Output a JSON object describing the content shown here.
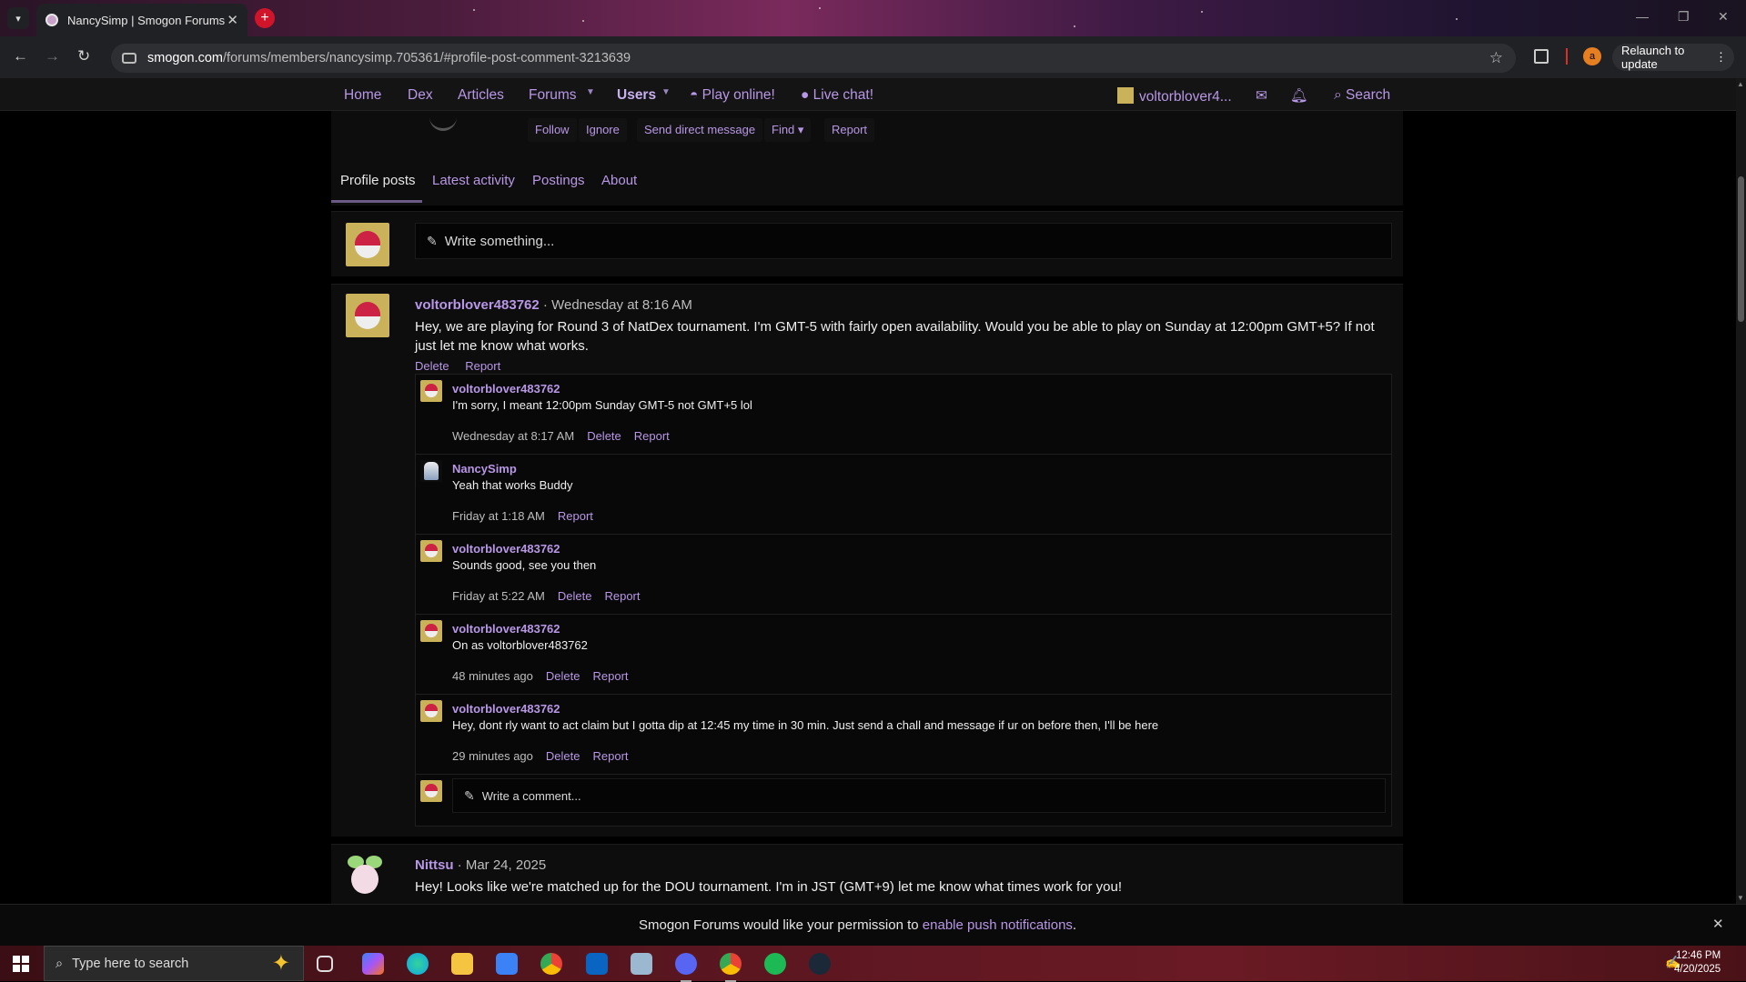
{
  "browser": {
    "tab_title": "NancySimp | Smogon Forums",
    "url_host": "smogon.com",
    "url_path": "/forums/members/nancysimp.705361/#profile-post-comment-3213639",
    "relaunch_label": "Relaunch to update",
    "profile_initial": "a"
  },
  "sitenav": {
    "home": "Home",
    "dex": "Dex",
    "articles": "Articles",
    "forums": "Forums",
    "users": "Users",
    "play_online": "Play online!",
    "live_chat": "Live chat!",
    "account": "voltorblover4...",
    "search": "Search"
  },
  "profile_actions": {
    "follow": "Follow",
    "ignore": "Ignore",
    "send_dm": "Send direct message",
    "find": "Find",
    "report": "Report"
  },
  "profile_tabs": {
    "profile_posts": "Profile posts",
    "latest_activity": "Latest activity",
    "postings": "Postings",
    "about": "About"
  },
  "write_placeholder": "Write something...",
  "post1": {
    "author": "voltorblover483762",
    "time": "· Wednesday at 8:16 AM",
    "body": "Hey, we are playing for Round 3 of NatDex tournament. I'm GMT-5 with fairly open availability. Would you be able to play on Sunday at 12:00pm GMT+5? If not just let me know what works.",
    "delete": "Delete",
    "report": "Report",
    "comments": [
      {
        "author": "voltorblover483762",
        "text": "I'm sorry, I meant 12:00pm Sunday GMT-5 not GMT+5 lol",
        "time": "Wednesday at 8:17 AM",
        "delete": "Delete",
        "report": "Report"
      },
      {
        "author": "NancySimp",
        "text": "Yeah that works Buddy",
        "time": "Friday at 1:18 AM",
        "report": "Report"
      },
      {
        "author": "voltorblover483762",
        "text": "Sounds good, see you then",
        "time": "Friday at 5:22 AM",
        "delete": "Delete",
        "report": "Report"
      },
      {
        "author": "voltorblover483762",
        "text": "On as voltorblover483762",
        "time": "48 minutes ago",
        "delete": "Delete",
        "report": "Report"
      },
      {
        "author": "voltorblover483762",
        "text": "Hey, dont rly want to act claim but I gotta dip at 12:45 my time in 30 min. Just send a chall and message if ur on before then, I'll be here",
        "time": "29 minutes ago",
        "delete": "Delete",
        "report": "Report"
      }
    ],
    "comment_placeholder": "Write a comment..."
  },
  "post2": {
    "author": "Nittsu",
    "time": "· Mar 24, 2025",
    "body": "Hey! Looks like we're matched up for the DOU tournament. I'm in JST (GMT+9) let me know what times work for you!"
  },
  "push": {
    "text": "Smogon Forums would like your permission to",
    "link": "enable push notifications",
    "end": "."
  },
  "taskbar": {
    "search_placeholder": "Type here to search",
    "time": "12:46 PM",
    "date": "4/20/2025"
  },
  "colors": {
    "accent": "#b897e6",
    "background": "#000000",
    "panel": "#0d0d0d"
  }
}
